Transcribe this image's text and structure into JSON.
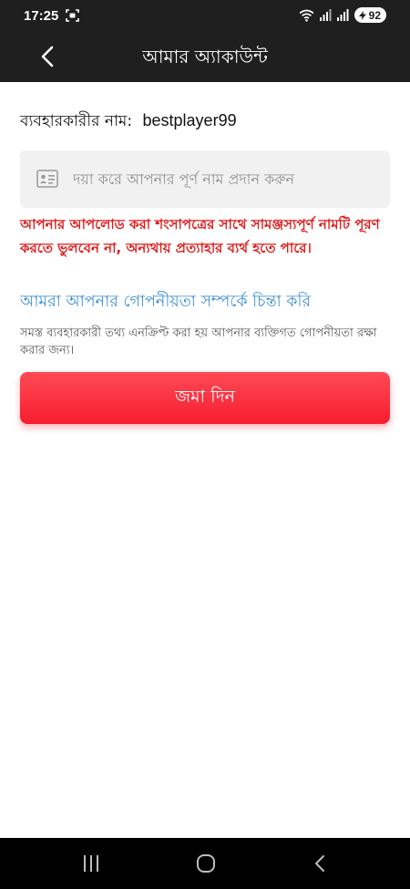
{
  "status_bar": {
    "time": "17:25",
    "battery": "92",
    "icons": [
      "screenshot-icon",
      "wifi-icon",
      "signal-icon",
      "signal-icon",
      "battery-icon"
    ]
  },
  "header": {
    "title": "আমার অ্যাকাউন্ট",
    "back_icon": "chevron-left-icon"
  },
  "account": {
    "username_label": "ব্যবহারকারীর নাম:",
    "username": "bestplayer99"
  },
  "name_field": {
    "placeholder": "দয়া করে আপনার পূর্ণ নাম প্রদান করুন",
    "value": "",
    "icon": "id-card-icon"
  },
  "warning_text": "আপনার আপলোড করা শংসাপত্রের সাথে সামঞ্জস্যপূর্ণ নামটি পূরণ করতে ভুলবেন না, অন্যথায় প্রত্যাহার ব্যর্থ হতে পারে।",
  "privacy": {
    "link_text": "আমরা আপনার গোপনীয়তা সম্পর্কে চিন্তা করি",
    "note": "সমস্ত ব্যবহারকারী তথ্য এনক্রিপ্ট করা হয় আপনার ব্যক্তিগত গোপনীয়তা রক্ষা করার জন্য।"
  },
  "submit_label": "জমা দিন",
  "colors": {
    "header_bg": "#1f1f1f",
    "warning": "#e21c1c",
    "link": "#3d8fd6",
    "button": "#f61d2e"
  },
  "nav_bar": {
    "icons": [
      "recents-icon",
      "home-icon",
      "back-icon"
    ]
  }
}
